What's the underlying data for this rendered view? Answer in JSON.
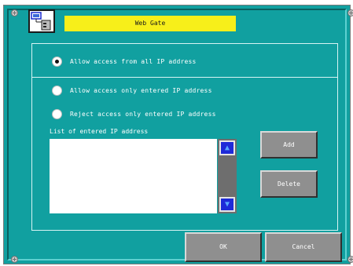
{
  "dialog": {
    "title": "Web Gate"
  },
  "access_options": [
    {
      "label": "Allow access from all IP address",
      "selected": true
    },
    {
      "label": "Allow access only entered IP address",
      "selected": false
    },
    {
      "label": "Reject access only entered IP address",
      "selected": false
    }
  ],
  "ip_list": {
    "label": "List of entered IP address",
    "entries": []
  },
  "buttons": {
    "add": "Add",
    "delete": "Delete",
    "ok": "OK",
    "cancel": "Cancel"
  },
  "icons": {
    "title": "network-computer-icon",
    "scroll_up": "triangle-up-icon",
    "scroll_down": "triangle-down-icon"
  },
  "colors": {
    "window": "#11a0a0",
    "title_bar": "#f7ef1a",
    "button": "#8f8f8f",
    "scroll_arrow": "#1e2ad8"
  }
}
